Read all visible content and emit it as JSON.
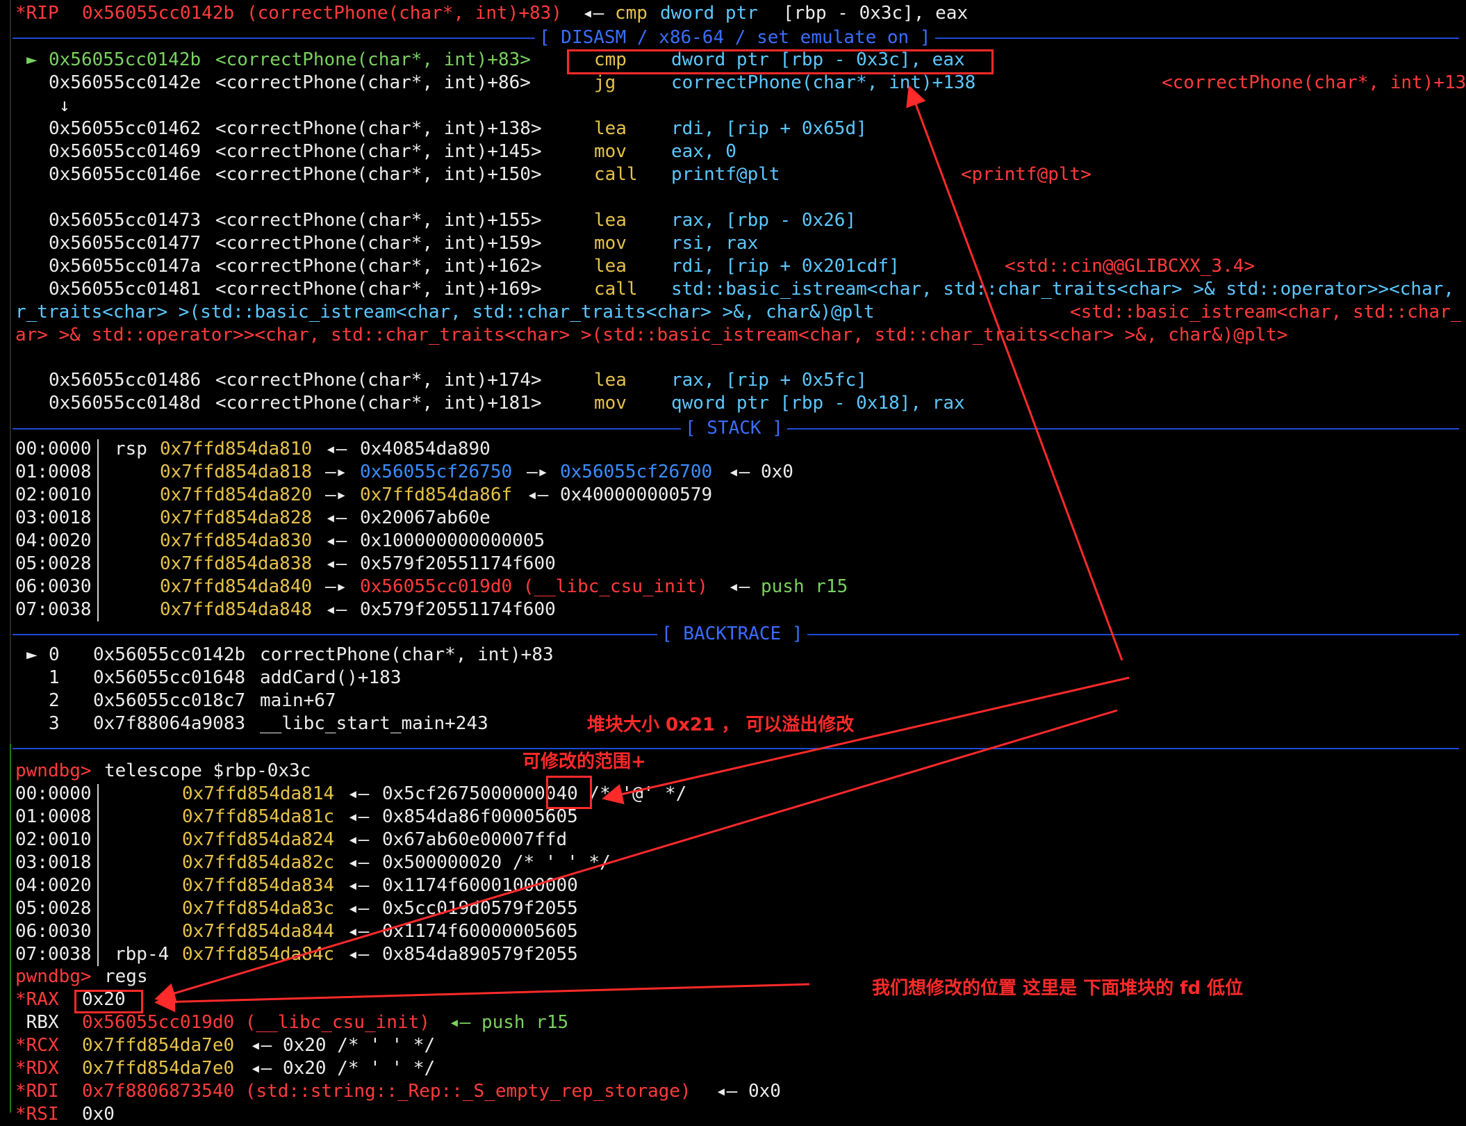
{
  "rip_line": {
    "label": "*RIP",
    "addr": "0x56055cc0142b",
    "sym": "(correctPhone(char*, int)+83)",
    "arrow": "◂—",
    "instr": "cmp",
    "operands_head": "dword ptr ",
    "operands_tail": "[rbp - 0x3c], eax"
  },
  "sections": {
    "disasm": "[ DISASM / x86-64 / set emulate on ]",
    "stack": "[ STACK ]",
    "backtrace": "[ BACKTRACE ]"
  },
  "disasm": [
    {
      "marker": "►",
      "addr": "0x56055cc0142b",
      "sym": "<correctPhone(char*, int)+83>",
      "mnem": "cmp",
      "ops": "dword ptr [rbp - 0x3c], eax",
      "note": ""
    },
    {
      "marker": "",
      "addr": "0x56055cc0142e",
      "sym": "<correctPhone(char*, int)+86>",
      "mnem": "jg",
      "ops": "correctPhone(char*, int)+138",
      "note": "<correctPhone(char*, int)+13"
    },
    {
      "marker": "↓",
      "addr": "",
      "sym": "",
      "mnem": "",
      "ops": "",
      "note": ""
    },
    {
      "marker": "",
      "addr": "0x56055cc01462",
      "sym": "<correctPhone(char*, int)+138>",
      "mnem": "lea",
      "ops": "rdi, [rip + 0x65d]",
      "note": ""
    },
    {
      "marker": "",
      "addr": "0x56055cc01469",
      "sym": "<correctPhone(char*, int)+145>",
      "mnem": "mov",
      "ops": "eax, 0",
      "note": ""
    },
    {
      "marker": "",
      "addr": "0x56055cc0146e",
      "sym": "<correctPhone(char*, int)+150>",
      "mnem": "call",
      "ops": "printf@plt",
      "note": "<printf@plt>"
    },
    {
      "marker": "",
      "addr": "",
      "sym": "",
      "mnem": "",
      "ops": "",
      "note": ""
    },
    {
      "marker": "",
      "addr": "0x56055cc01473",
      "sym": "<correctPhone(char*, int)+155>",
      "mnem": "lea",
      "ops": "rax, [rbp - 0x26]",
      "note": ""
    },
    {
      "marker": "",
      "addr": "0x56055cc01477",
      "sym": "<correctPhone(char*, int)+159>",
      "mnem": "mov",
      "ops": "rsi, rax",
      "note": ""
    },
    {
      "marker": "",
      "addr": "0x56055cc0147a",
      "sym": "<correctPhone(char*, int)+162>",
      "mnem": "lea",
      "ops": "rdi, [rip + 0x201cdf]",
      "note": "<std::cin@@GLIBCXX_3.4>"
    },
    {
      "marker": "",
      "addr": "0x56055cc01481",
      "sym": "<correctPhone(char*, int)+169>",
      "mnem": "call",
      "ops": "std::basic_istream<char, std::char_traits<char> >& std::operator>><char,",
      "note": ""
    }
  ],
  "disasm_wrap": [
    {
      "text": "r_traits<char> >(std::basic_istream<char, std::char_traits<char> >&, char&)@plt",
      "note": "<std::basic_istream<char, std::char_"
    },
    {
      "text": "ar> >& std::operator>><char, std::char_traits<char> >(std::basic_istream<char, std::char_traits<char> >&, char&)@plt>",
      "note": ""
    }
  ],
  "disasm2": [
    {
      "addr": "0x56055cc01486",
      "sym": "<correctPhone(char*, int)+174>",
      "mnem": "lea",
      "ops": "rax, [rip + 0x5fc]"
    },
    {
      "addr": "0x56055cc0148d",
      "sym": "<correctPhone(char*, int)+181>",
      "mnem": "mov",
      "ops": "qword ptr [rbp - 0x18], rax"
    }
  ],
  "stack": [
    {
      "idx": "00:0000",
      "reg": "rsp",
      "addr": "0x7ffd854da810",
      "arrow": "◂—",
      "v1": "0x40854da890",
      "a2": "",
      "v2": "",
      "a3": "",
      "v3": ""
    },
    {
      "idx": "01:0008",
      "reg": "",
      "addr": "0x7ffd854da818",
      "arrow": "—▸",
      "v1": "0x56055cf26750",
      "a2": "—▸",
      "v2": "0x56055cf26700",
      "a3": "◂—",
      "v3": "0x0"
    },
    {
      "idx": "02:0010",
      "reg": "",
      "addr": "0x7ffd854da820",
      "arrow": "—▸",
      "v1": "0x7ffd854da86f",
      "a2": "◂—",
      "v2": "0x400000000579",
      "a3": "",
      "v3": ""
    },
    {
      "idx": "03:0018",
      "reg": "",
      "addr": "0x7ffd854da828",
      "arrow": "◂—",
      "v1": "0x20067ab60e",
      "a2": "",
      "v2": "",
      "a3": "",
      "v3": ""
    },
    {
      "idx": "04:0020",
      "reg": "",
      "addr": "0x7ffd854da830",
      "arrow": "◂—",
      "v1": "0x100000000000005",
      "a2": "",
      "v2": "",
      "a3": "",
      "v3": ""
    },
    {
      "idx": "05:0028",
      "reg": "",
      "addr": "0x7ffd854da838",
      "arrow": "◂—",
      "v1": "0x579f20551174f600",
      "a2": "",
      "v2": "",
      "a3": "",
      "v3": ""
    },
    {
      "idx": "06:0030",
      "reg": "",
      "addr": "0x7ffd854da840",
      "arrow": "—▸",
      "v1": "0x56055cc019d0 (__libc_csu_init)",
      "a2": "◂—",
      "v2": "push r15",
      "a3": "",
      "v3": ""
    },
    {
      "idx": "07:0038",
      "reg": "",
      "addr": "0x7ffd854da848",
      "arrow": "◂—",
      "v1": "0x579f20551174f600",
      "a2": "",
      "v2": "",
      "a3": "",
      "v3": ""
    }
  ],
  "backtrace": [
    {
      "marker": "►",
      "n": "0",
      "addr": "0x56055cc0142b",
      "sym": "correctPhone(char*, int)+83"
    },
    {
      "marker": "",
      "n": "1",
      "addr": "0x56055cc01648",
      "sym": "addCard()+183"
    },
    {
      "marker": "",
      "n": "2",
      "addr": "0x56055cc018c7",
      "sym": "main+67"
    },
    {
      "marker": "",
      "n": "3",
      "addr": "0x7f88064a9083",
      "sym": "__libc_start_main+243"
    }
  ],
  "telescope": {
    "prompt": "pwndbg>",
    "cmd": "telescope $rbp-0x3c",
    "rows": [
      {
        "idx": "00:0000",
        "reg": "",
        "addr": "0x7ffd854da814",
        "arrow": "◂—",
        "val": "0x5cf2675000000040 /* '@' */"
      },
      {
        "idx": "01:0008",
        "reg": "",
        "addr": "0x7ffd854da81c",
        "arrow": "◂—",
        "val": "0x854da86f00005605"
      },
      {
        "idx": "02:0010",
        "reg": "",
        "addr": "0x7ffd854da824",
        "arrow": "◂—",
        "val": "0x67ab60e00007ffd"
      },
      {
        "idx": "03:0018",
        "reg": "",
        "addr": "0x7ffd854da82c",
        "arrow": "◂—",
        "val": "0x500000020 /* ' ' */"
      },
      {
        "idx": "04:0020",
        "reg": "",
        "addr": "0x7ffd854da834",
        "arrow": "◂—",
        "val": "0x1174f60001000000"
      },
      {
        "idx": "05:0028",
        "reg": "",
        "addr": "0x7ffd854da83c",
        "arrow": "◂—",
        "val": "0x5cc019d0579f2055"
      },
      {
        "idx": "06:0030",
        "reg": "",
        "addr": "0x7ffd854da844",
        "arrow": "◂—",
        "val": "0x1174f60000005605"
      },
      {
        "idx": "07:0038",
        "reg": "rbp-4",
        "addr": "0x7ffd854da84c",
        "arrow": "◂—",
        "val": "0x854da890579f2055"
      }
    ]
  },
  "regs": {
    "prompt": "pwndbg>",
    "cmd": "regs",
    "rows": [
      {
        "name": "*RAX",
        "val": "0x20",
        "rest": ""
      },
      {
        "name": " RBX",
        "val": "0x56055cc019d0 (__libc_csu_init)",
        "rest": "◂— push r15"
      },
      {
        "name": "*RCX",
        "val": "0x7ffd854da7e0",
        "rest": "◂— 0x20 /* ' ' */"
      },
      {
        "name": "*RDX",
        "val": "0x7ffd854da7e0",
        "rest": "◂— 0x20 /* ' ' */"
      },
      {
        "name": "*RDI",
        "val": "0x7f8806873540 (std::string::_Rep::_S_empty_rep_storage)",
        "rest": "◂— 0x0"
      },
      {
        "name": "*RSI",
        "val": "0x0",
        "rest": ""
      }
    ]
  },
  "annotations": {
    "heap_size_note": "堆块大小 0x21 ， 可以溢出修改",
    "range_note": "可修改的范围+",
    "target_note": "我们想修改的位置 这里是 下面堆块的 fd 低位"
  },
  "colors": {
    "annotation": "#ff2a2a",
    "separator": "#1f4ad6",
    "address": "#e6c24a",
    "symbol": "#ff3b3b",
    "mnemonic": "#e6c24a",
    "register": "#5cc8ff"
  }
}
